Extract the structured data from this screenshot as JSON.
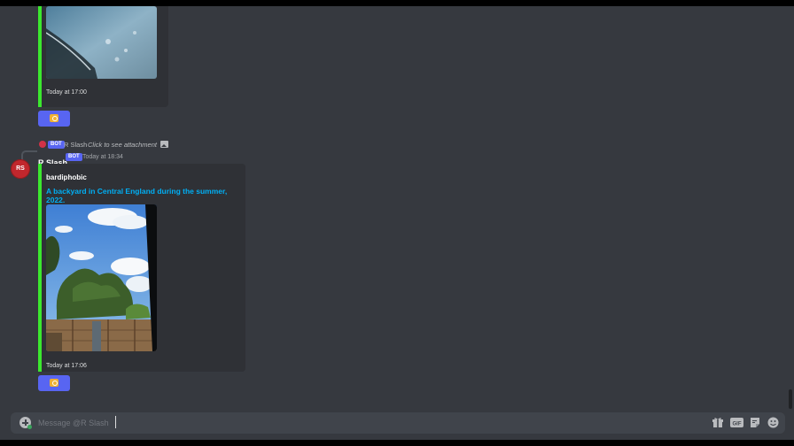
{
  "messages": [
    {
      "embed_timestamp": "Today at 17:00"
    },
    {
      "reply_preview": {
        "bot_tag": "BOT",
        "author": "R Slash",
        "text": "Click to see attachment"
      },
      "avatar_initials": "RS",
      "author": "R Slash",
      "bot_tag": "BOT",
      "timestamp": "Today at 18:34",
      "embed": {
        "author": "bardiphobic",
        "title": "A backyard in Central England during the summer, 2022.",
        "timestamp": "Today at 17:06"
      }
    }
  ],
  "composer": {
    "placeholder": "Message @R Slash"
  },
  "composer_icons": [
    "gift-icon",
    "gif-icon",
    "sticker-icon",
    "emoji-icon"
  ],
  "colors": {
    "embed_accent": "#3be82e",
    "link": "#00aff4",
    "blurple": "#5865f2",
    "background": "#36393f"
  }
}
